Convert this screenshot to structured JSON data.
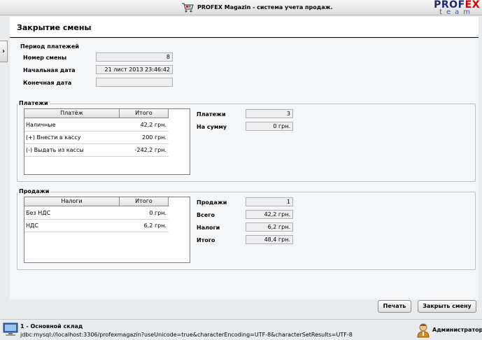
{
  "window": {
    "title": "PROFEX Magazin - система учета продаж."
  },
  "brand": {
    "top_a": "PROF",
    "top_b": "EX",
    "sub": "team"
  },
  "page": {
    "title": "Закрытие смены"
  },
  "period": {
    "legend": "Период платежей",
    "shift_label": "Номер смены",
    "shift_value": "8",
    "start_label": "Начальная дата",
    "start_value": "21 лист 2013 23:46:42",
    "end_label": "Конечная дата",
    "end_value": ""
  },
  "payments": {
    "legend": "Платежи",
    "columns": [
      "Платёж",
      "Итого"
    ],
    "rows": [
      {
        "name": "Наличные",
        "total": "42,2 грн."
      },
      {
        "name": "(+) Внести в кассу",
        "total": "200 грн."
      },
      {
        "name": "(-) Выдать из кассы",
        "total": "-242,2 грн."
      }
    ],
    "count_label": "Платежи",
    "count_value": "3",
    "sum_label": "На сумму",
    "sum_value": "0 грн."
  },
  "sales": {
    "legend": "Продажи",
    "columns": [
      "Налоги",
      "Итого"
    ],
    "rows": [
      {
        "name": "Без НДС",
        "total": "0 грн."
      },
      {
        "name": "НДС",
        "total": "6,2 грн."
      }
    ],
    "sales_label": "Продажи",
    "sales_value": "1",
    "all_label": "Всего",
    "all_value": "42,2 грн.",
    "tax_label": "Налоги",
    "tax_value": "6,2 грн.",
    "total_label": "Итого",
    "total_value": "48,4 грн."
  },
  "buttons": {
    "print": "Печать",
    "close_shift": "Закрыть смену"
  },
  "status": {
    "warehouse": "1 - Основной склад",
    "connection": "jdbc:mysql://localhost:3306/profexmagazin?useUnicode=true&characterEncoding=UTF-8&characterSetResults=UTF-8",
    "user": "Администратор1"
  },
  "colors": {
    "brand_dark": "#1f2a70",
    "brand_red": "#d40000",
    "panel_border": "#b9c3cf"
  },
  "icons": {
    "app": "shopping-cart-icon",
    "side": "chevron-right-icon",
    "computer": "computer-icon",
    "user": "user-icon"
  }
}
